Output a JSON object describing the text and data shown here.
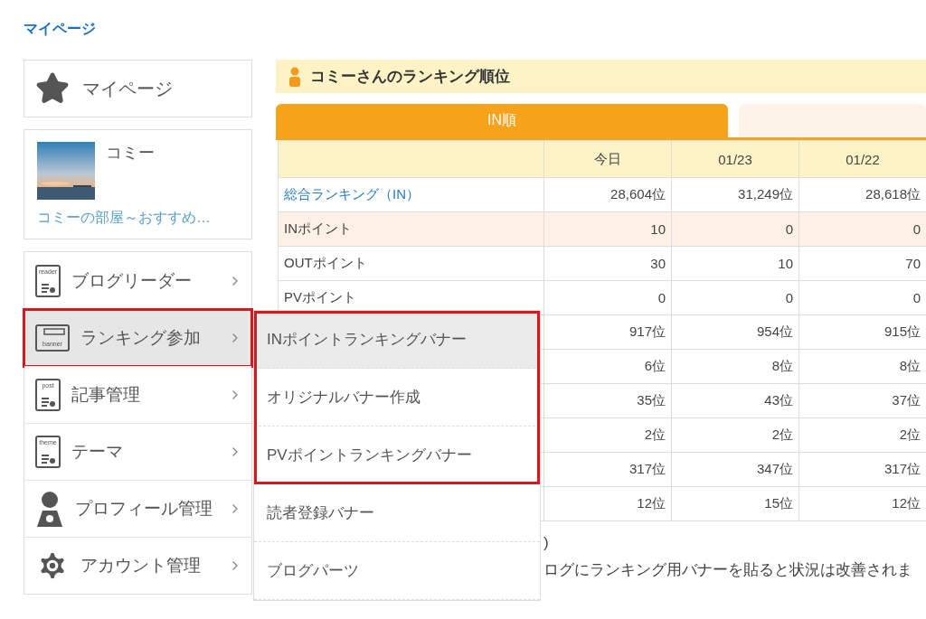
{
  "breadcrumb": "マイページ",
  "sidebar": {
    "mypage": {
      "label": "マイページ"
    },
    "profile": {
      "name": "コミー",
      "blog_title": "コミーの部屋～おすすめ…"
    },
    "nav": [
      {
        "kind": "labeled",
        "icon_label": "reader",
        "label": "ブログリーダー",
        "selected": false,
        "highlighted": false
      },
      {
        "kind": "banner",
        "icon_label": "banner",
        "label": "ランキング参加",
        "selected": true,
        "highlighted": true,
        "submenu": [
          {
            "label": "INポイントランキングバナー",
            "selected": true,
            "highlighted": true
          },
          {
            "label": "オリジナルバナー作成",
            "selected": false,
            "highlighted": true
          },
          {
            "label": "PVポイントランキングバナー",
            "selected": false,
            "highlighted": true
          },
          {
            "label": "読者登録バナー",
            "selected": false,
            "highlighted": false
          },
          {
            "label": "ブログパーツ",
            "selected": false,
            "highlighted": false
          }
        ]
      },
      {
        "kind": "labeled",
        "icon_label": "post",
        "label": "記事管理",
        "selected": false,
        "highlighted": false
      },
      {
        "kind": "labeled",
        "icon_label": "theme",
        "label": "テーマ",
        "selected": false,
        "highlighted": false
      },
      {
        "kind": "profile",
        "label": "プロフィール管理",
        "selected": false,
        "highlighted": false
      },
      {
        "kind": "account",
        "label": "アカウント管理",
        "selected": false,
        "highlighted": false
      }
    ]
  },
  "ranking": {
    "title": "コミーさんのランキング順位",
    "tabs": [
      {
        "label": "IN順",
        "selected": true
      },
      {
        "selected": false
      }
    ],
    "table": {
      "columns": [
        "今日",
        "01/23",
        "01/22"
      ],
      "rows": [
        {
          "label": "総合ランキング（IN）",
          "link": true,
          "shaded": false,
          "cells": [
            "28,604位",
            "31,249位",
            "28,618位"
          ]
        },
        {
          "label": "INポイント",
          "link": false,
          "shaded": true,
          "cells": [
            "10",
            "0",
            "0"
          ]
        },
        {
          "label": "OUTポイント",
          "link": false,
          "shaded": false,
          "cells": [
            "30",
            "10",
            "70"
          ]
        },
        {
          "label": "PVポイント",
          "link": false,
          "shaded": false,
          "cells": [
            "0",
            "0",
            "0"
          ]
        },
        {
          "shaded": false,
          "cells": [
            "917位",
            "954位",
            "915位"
          ]
        },
        {
          "shaded": false,
          "cells": [
            "6位",
            "8位",
            "8位"
          ]
        },
        {
          "shaded": false,
          "cells": [
            "35位",
            "43位",
            "37位"
          ]
        },
        {
          "shaded": false,
          "cells": [
            "2位",
            "2位",
            "2位"
          ]
        },
        {
          "shaded": false,
          "cells": [
            "317位",
            "347位",
            "317位"
          ]
        },
        {
          "shaded": false,
          "cells": [
            "12位",
            "15位",
            "12位"
          ]
        }
      ]
    },
    "notes": [
      ")",
      "ログにランキング用バナーを貼ると状況は改善されま"
    ]
  }
}
